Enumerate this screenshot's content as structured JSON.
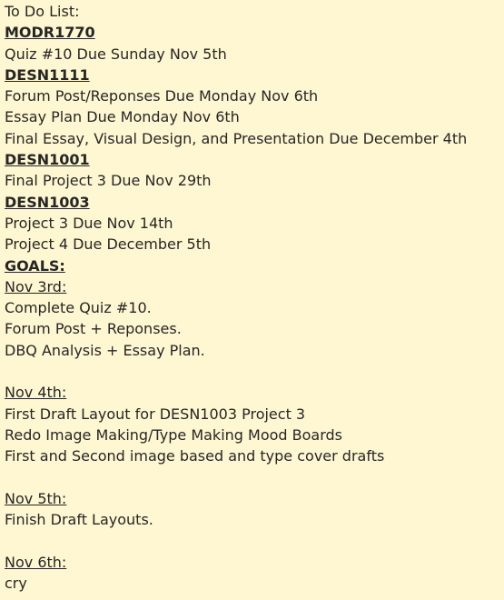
{
  "note": {
    "title": "To Do List:",
    "courses": [
      {
        "code": "MODR1770",
        "items": [
          "Quiz #10 Due Sunday Nov 5th"
        ]
      },
      {
        "code": "DESN1111",
        "items": [
          "Forum Post/Reponses Due Monday Nov 6th",
          "Essay Plan Due Monday Nov 6th",
          "Final Essay, Visual Design, and Presentation Due December 4th"
        ]
      },
      {
        "code": "DESN1001",
        "items": [
          "Final Project 3 Due Nov 29th"
        ]
      },
      {
        "code": "DESN1003",
        "items": [
          "Project 3 Due Nov 14th",
          "Project 4 Due December 5th"
        ]
      }
    ],
    "goals_label": "GOALS:",
    "goals": [
      {
        "date": "Nov 3rd:",
        "items": [
          "Complete Quiz #10.",
          "Forum Post + Reponses.",
          "DBQ Analysis + Essay Plan."
        ]
      },
      {
        "date": "Nov 4th:",
        "items": [
          "First Draft Layout for DESN1003 Project 3",
          "Redo Image Making/Type Making Mood Boards",
          "First and Second image based and type cover drafts"
        ]
      },
      {
        "date": "Nov 5th:",
        "items": [
          "Finish Draft Layouts."
        ]
      },
      {
        "date": "Nov 6th:",
        "items": [
          "cry"
        ]
      }
    ],
    "background_color": "#fff7d1",
    "text_color": "#262626"
  }
}
